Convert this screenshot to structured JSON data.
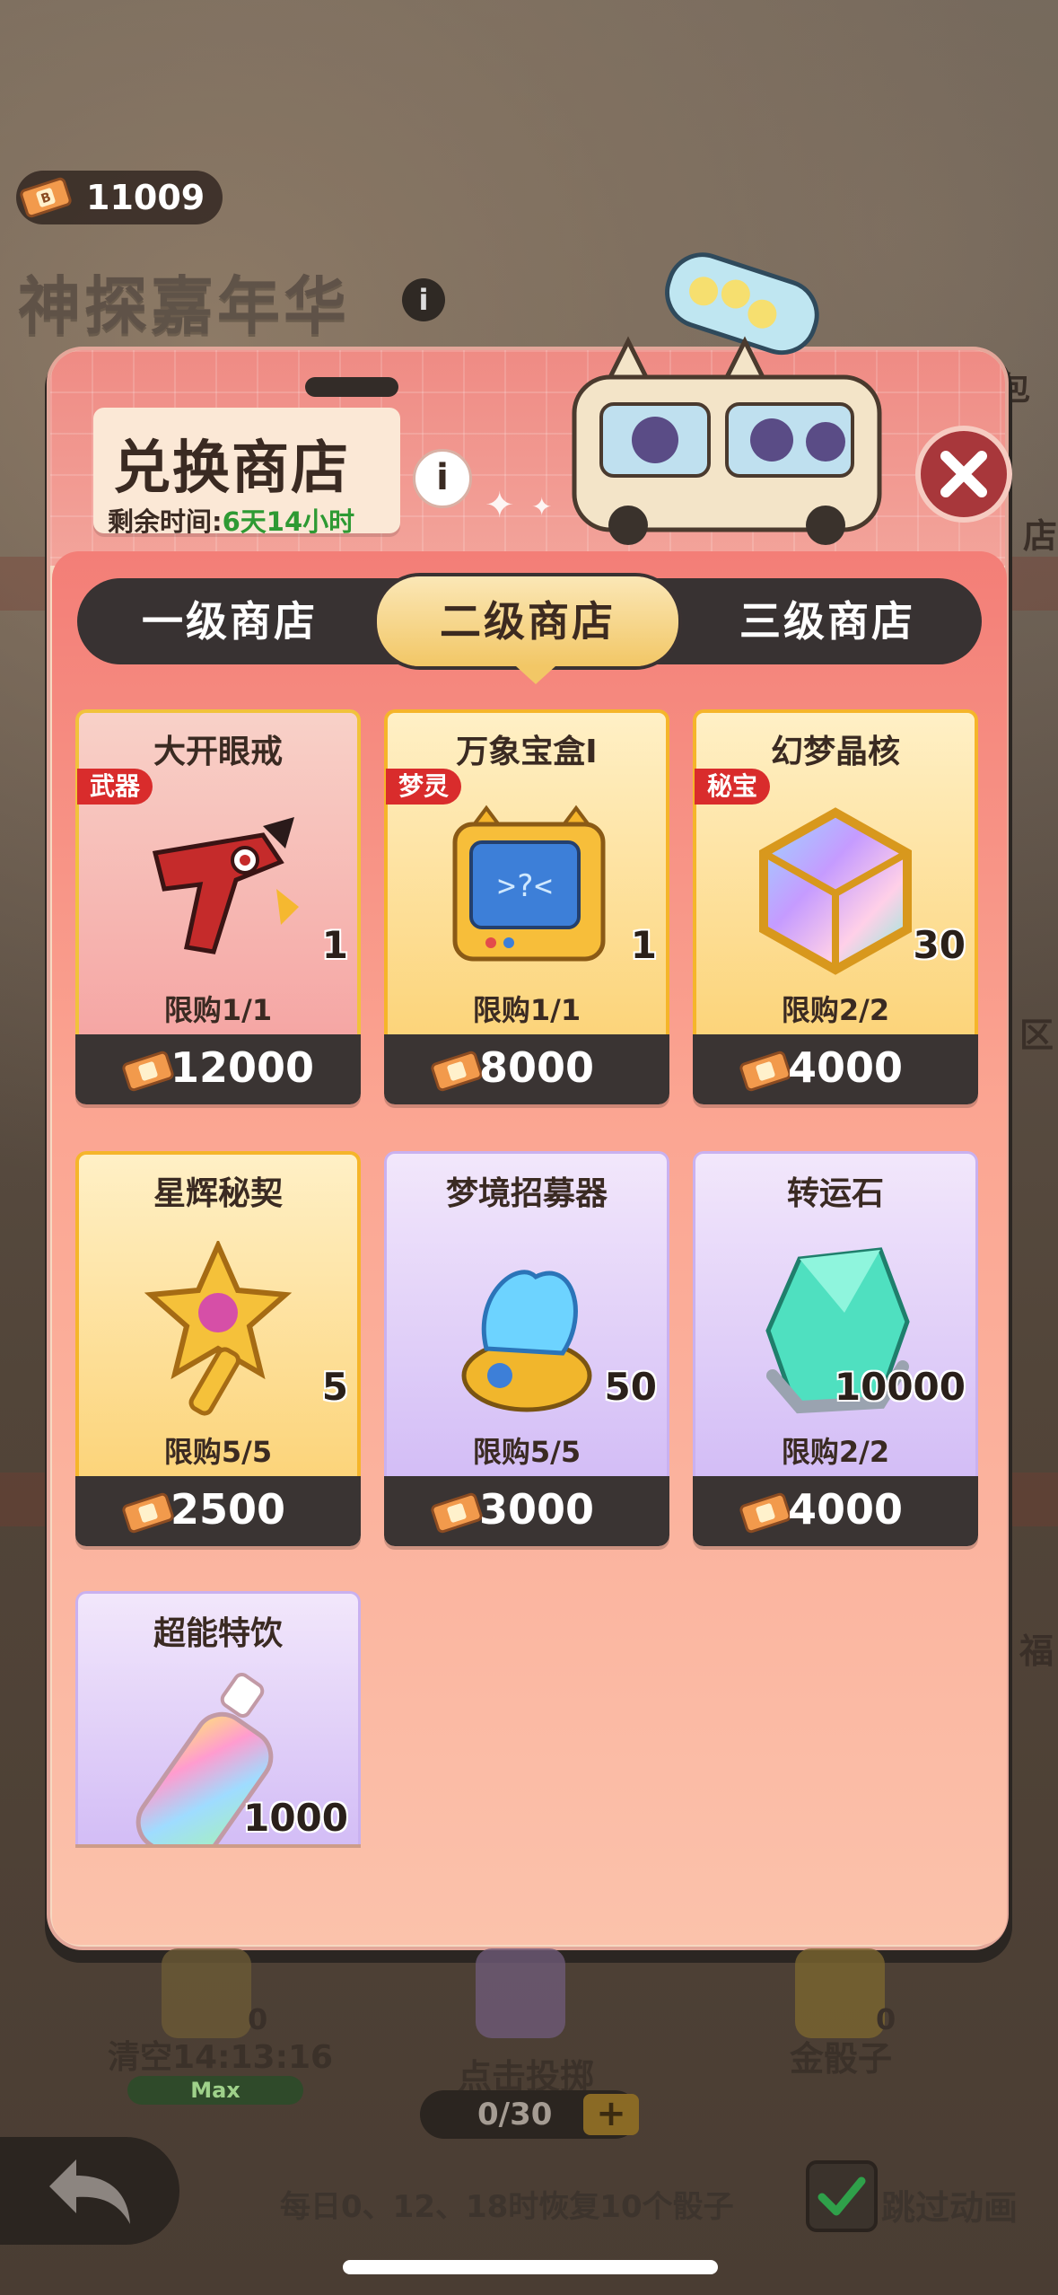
{
  "currency": {
    "amount": "11009",
    "icon": "ticket-icon"
  },
  "event": {
    "title": "神探嘉年华",
    "info": "i"
  },
  "background_labels": {
    "gift": "会礼包",
    "store_side": "店",
    "region": "区",
    "tickets_side": "福"
  },
  "shop": {
    "title": "兑换商店",
    "info": "i",
    "time_label": "剩余时间:",
    "time_value": "6天14小时",
    "close_icon": "close-icon"
  },
  "tabs": [
    {
      "label": "一级商店",
      "active": false
    },
    {
      "label": "二级商店",
      "active": true
    },
    {
      "label": "三级商店",
      "active": false
    }
  ],
  "items": [
    {
      "name": "大开眼戒",
      "tag": "武器",
      "qty": "1",
      "limit": "限购1/1",
      "price": "12000",
      "style": "red",
      "icon": "red-pistol-icon"
    },
    {
      "name": "万象宝盒Ⅰ",
      "tag": "梦灵",
      "qty": "1",
      "limit": "限购1/1",
      "price": "8000",
      "style": "gold",
      "icon": "tv-box-icon"
    },
    {
      "name": "幻梦晶核",
      "tag": "秘宝",
      "qty": "30",
      "limit": "限购2/2",
      "price": "4000",
      "style": "gold",
      "icon": "crystal-cube-icon"
    },
    {
      "name": "星辉秘契",
      "tag": "",
      "qty": "5",
      "limit": "限购5/5",
      "price": "2500",
      "style": "gold",
      "icon": "star-key-icon"
    },
    {
      "name": "梦境招募器",
      "tag": "",
      "qty": "50",
      "limit": "限购5/5",
      "price": "3000",
      "style": "purple",
      "icon": "recruiter-icon"
    },
    {
      "name": "转运石",
      "tag": "",
      "qty": "10000",
      "limit": "限购2/2",
      "price": "4000",
      "style": "purple",
      "icon": "green-gem-icon"
    },
    {
      "name": "超能特饮",
      "tag": "",
      "qty": "1000",
      "limit": "",
      "price": "",
      "style": "purple",
      "icon": "rainbow-bottle-icon"
    }
  ],
  "bottom": {
    "clear_time": "清空14:13:16",
    "max": "Max",
    "dice_left_count": "0",
    "tap_roll": "点击投掷",
    "roll_count": "0/30",
    "roll_plus": "+",
    "gold_dice": "金骰子",
    "gold_dice_count": "0",
    "hint": "每日0、12、18时恢复10个骰子",
    "skip": "跳过动画"
  }
}
